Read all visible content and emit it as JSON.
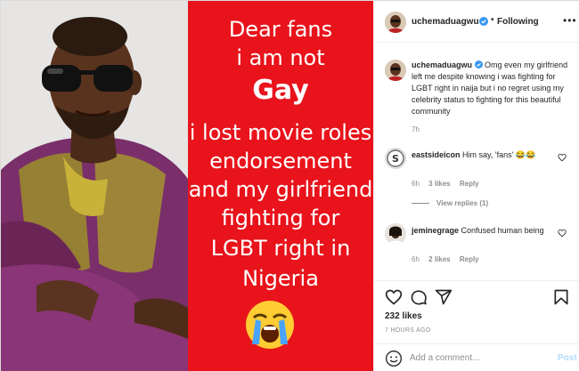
{
  "media": {
    "caption_lines": [
      "Dear fans",
      "i am not",
      "Gay",
      "i lost movie roles",
      "endorsement",
      "and my girlfriend",
      "fighting for",
      "LGBT right in",
      "Nigeria"
    ],
    "emoji": "loudly-crying-face",
    "colors": {
      "panel_red": "#e8131b",
      "caption_text": "#ffffff"
    }
  },
  "header": {
    "username": "uchemaduagwu",
    "separator": "•",
    "follow_label": "Following",
    "more_icon": "more-horizontal-icon"
  },
  "caption": {
    "username": "uchemaduagwu",
    "text": "Omg even my girlfriend left me despite knowing i was fighting for LGBT right in naija but i no regret using my celebrity status to fighting for this beautiful community",
    "time": "7h"
  },
  "comments": [
    {
      "username": "eastsideicon",
      "text": "Him say, 'fans' 😂😂",
      "time": "6h",
      "likes": "3 likes",
      "reply": "Reply",
      "view_replies": "View replies (1)"
    },
    {
      "username": "jeminegrage",
      "text": "Confused human being",
      "time": "6h",
      "likes": "2 likes",
      "reply": "Reply"
    }
  ],
  "actions": {
    "likes": "232 likes",
    "time_ago": "7 HOURS AGO",
    "comment_placeholder": "Add a comment...",
    "post_label": "Post"
  },
  "colors": {
    "text": "#262626",
    "muted": "#8e8e8e",
    "verified_blue": "#3897f0",
    "post_disabled": "#b3dbff"
  }
}
